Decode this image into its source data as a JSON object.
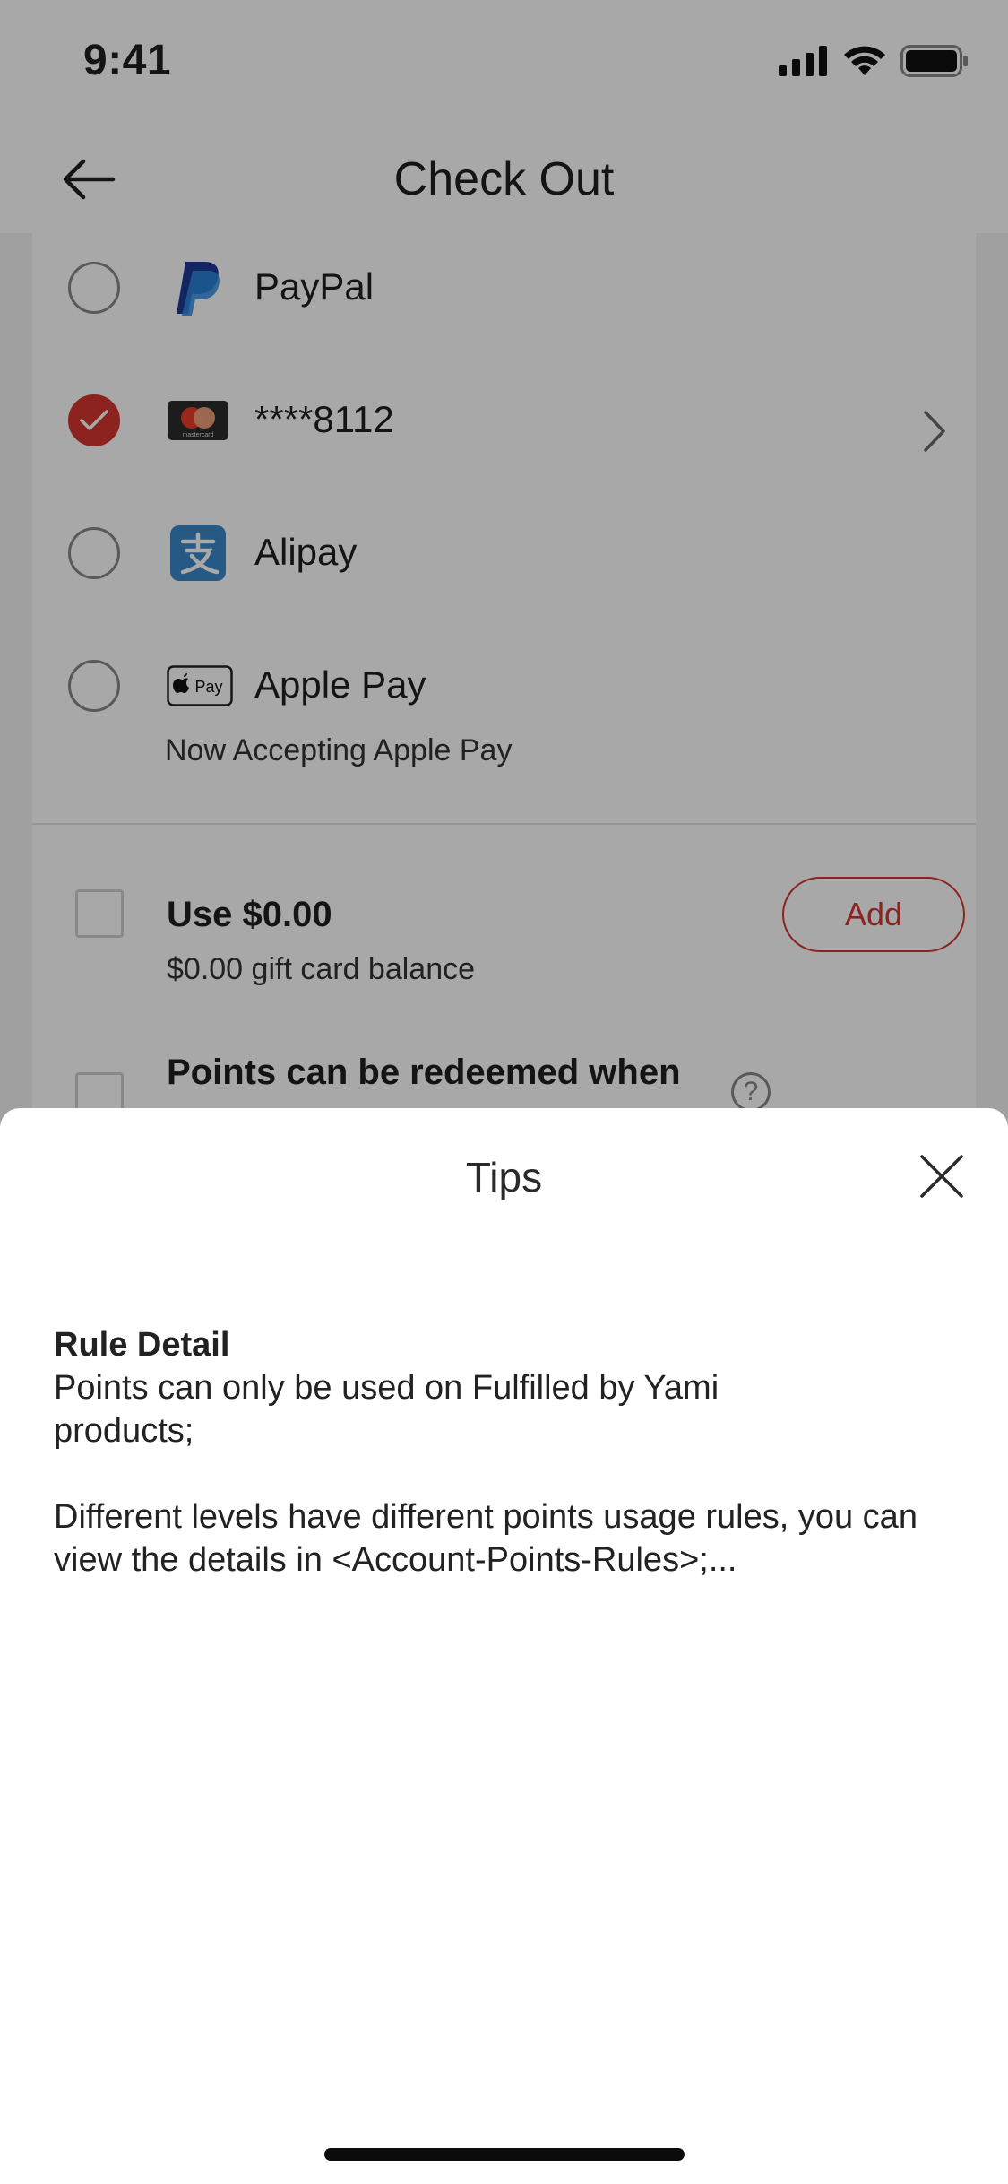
{
  "status_bar": {
    "time": "9:41"
  },
  "nav": {
    "title": "Check Out"
  },
  "payment_methods": [
    {
      "label": "PayPal",
      "selected": false,
      "logo": "paypal-logo"
    },
    {
      "label": "****8112",
      "selected": true,
      "logo": "mastercard-logo",
      "logo_text": "mastercard"
    },
    {
      "label": "Alipay",
      "selected": false,
      "logo": "alipay-logo"
    },
    {
      "label": "Apple Pay",
      "selected": false,
      "logo": "apple-pay-logo",
      "logo_text": "Pay",
      "sub_label": "Now Accepting Apple Pay"
    }
  ],
  "gift_card": {
    "title": "Use $0.00",
    "subtitle": "$0.00 gift card balance",
    "add_label": "Add"
  },
  "points": {
    "title": "Points can be redeemed when",
    "help_icon_text": "?"
  },
  "sheet": {
    "title": "Tips",
    "rule_heading": "Rule Detail",
    "rule_line_1": "Points can only be used on Fulfilled by Yami products;",
    "rule_line_2": "Different levels have different points usage rules, you can view the details in <Account-Points-Rules>;..."
  },
  "colors": {
    "accent": "#d5362f",
    "scrim": "rgba(0,0,0,0.34)",
    "paypal_blue": "#1f3a93",
    "alipay_blue": "#3a87c8"
  }
}
